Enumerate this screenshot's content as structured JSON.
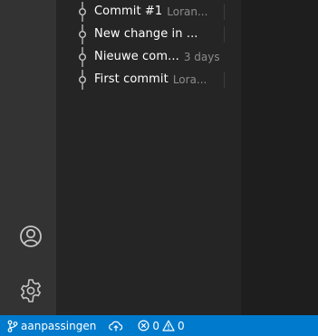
{
  "timeline": {
    "rows": [
      {
        "label": "Commit #1",
        "description": "Loran..."
      },
      {
        "label": "New change in ...",
        "description": ""
      },
      {
        "label": "Nieuwe com...",
        "description": "3 days"
      },
      {
        "label": "First commit",
        "description": "Lora..."
      }
    ]
  },
  "activity_bar": {
    "account_icon": "account-icon",
    "manage_icon": "gear-icon"
  },
  "status_bar": {
    "branch_icon": "source-control-branch-icon",
    "branch": "aanpassingen",
    "sync_icon": "cloud-sync-icon",
    "errors_count": "0",
    "warnings_count": "0"
  },
  "colors": {
    "status_bar": "#007acc",
    "activity_bar": "#333333",
    "side_panel": "#252526",
    "editor": "#1e1e1e"
  }
}
